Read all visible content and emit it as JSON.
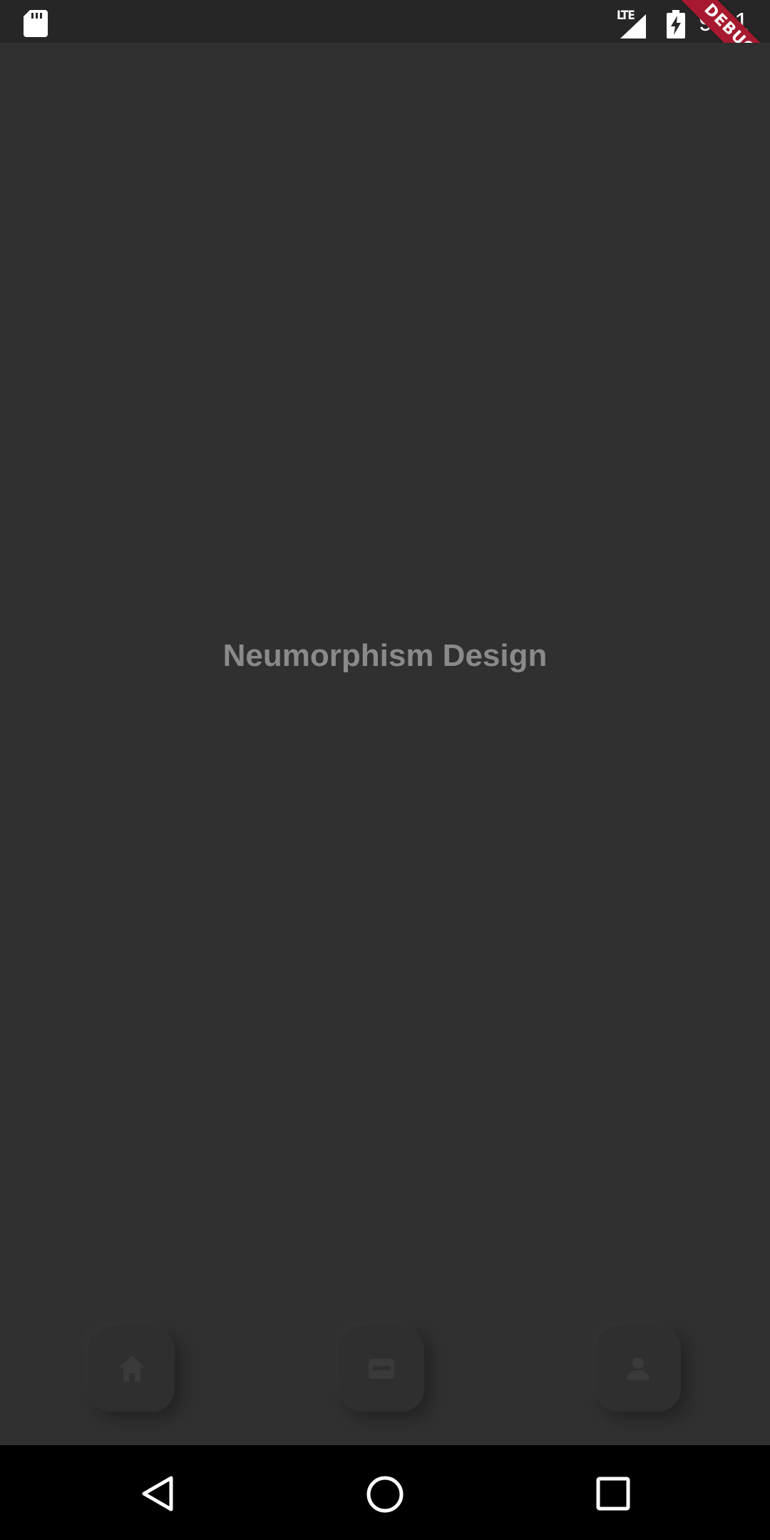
{
  "status_bar": {
    "network_label": "LTE",
    "time": "9:01",
    "debug_banner": "DEBUG"
  },
  "main": {
    "title": "Neumorphism Design"
  },
  "bottom_nav": {
    "items": [
      {
        "icon": "home-icon"
      },
      {
        "icon": "inbox-icon"
      },
      {
        "icon": "person-icon"
      }
    ]
  },
  "system_nav": {
    "items": [
      {
        "icon": "back-icon"
      },
      {
        "icon": "home-circle-icon"
      },
      {
        "icon": "recents-icon"
      }
    ]
  },
  "colors": {
    "background": "#303030",
    "status_bar": "#262626",
    "title_text": "#8a8a8a",
    "debug_ribbon": "#a6192e",
    "system_nav": "#000000"
  }
}
